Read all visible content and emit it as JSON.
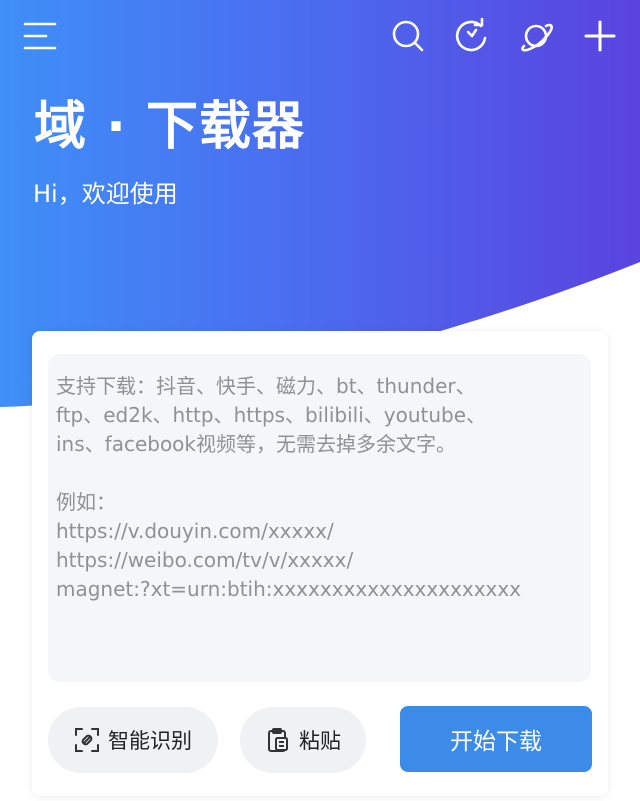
{
  "app": {
    "title": "域 · 下载器",
    "greeting": "Hi，欢迎使用"
  },
  "toolbar": {
    "icons": [
      "menu-icon",
      "search-icon",
      "refresh-icon",
      "planet-icon",
      "add-icon"
    ]
  },
  "input": {
    "placeholder_lines": [
      "支持下载：抖音、快手、磁力、bt、thunder、",
      "ftp、ed2k、http、https、bilibili、youtube、",
      "ins、facebook视频等，无需去掉多余文字。",
      "",
      "例如：",
      "https://v.douyin.com/xxxxx/",
      "https://weibo.com/tv/v/xxxxx/",
      "magnet:?xt=urn:btih:xxxxxxxxxxxxxxxxxxxxx"
    ]
  },
  "buttons": {
    "smart_recognize": "智能识别",
    "paste": "粘贴",
    "start_download": "开始下载"
  },
  "colors": {
    "gradient_start": "#3f8ff7",
    "gradient_end": "#5a43df",
    "primary_button": "#3c8be9",
    "placeholder_text": "#8f9295"
  }
}
